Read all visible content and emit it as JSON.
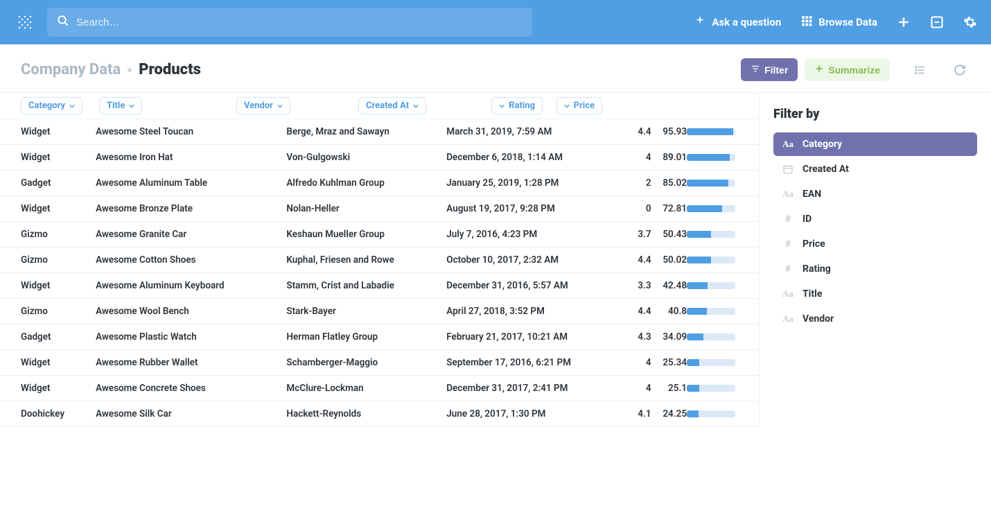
{
  "topbar": {
    "search_placeholder": "Search…",
    "ask_question": "Ask a question",
    "browse_data": "Browse Data"
  },
  "breadcrumb": {
    "root": "Company Data",
    "current": "Products"
  },
  "header_actions": {
    "filter": "Filter",
    "summarize": "Summarize"
  },
  "columns": {
    "category": "Category",
    "title": "Title",
    "vendor": "Vendor",
    "created_at": "Created At",
    "rating": "Rating",
    "price": "Price"
  },
  "max_price": 100,
  "rows": [
    {
      "category": "Widget",
      "title": "Awesome Steel Toucan",
      "vendor": "Berge, Mraz and Sawayn",
      "created_at": "March 31, 2019, 7:59 AM",
      "rating": "4.4",
      "price": "95.93"
    },
    {
      "category": "Widget",
      "title": "Awesome Iron Hat",
      "vendor": "Von-Gulgowski",
      "created_at": "December 6, 2018, 1:14 AM",
      "rating": "4",
      "price": "89.01"
    },
    {
      "category": "Gadget",
      "title": "Awesome Aluminum Table",
      "vendor": "Alfredo Kuhlman Group",
      "created_at": "January 25, 2019, 1:28 PM",
      "rating": "2",
      "price": "85.02"
    },
    {
      "category": "Widget",
      "title": "Awesome Bronze Plate",
      "vendor": "Nolan-Heller",
      "created_at": "August 19, 2017, 9:28 PM",
      "rating": "0",
      "price": "72.81"
    },
    {
      "category": "Gizmo",
      "title": "Awesome Granite Car",
      "vendor": "Keshaun Mueller Group",
      "created_at": "July 7, 2016, 4:23 PM",
      "rating": "3.7",
      "price": "50.43"
    },
    {
      "category": "Gizmo",
      "title": "Awesome Cotton Shoes",
      "vendor": "Kuphal, Friesen and Rowe",
      "created_at": "October 10, 2017, 2:32 AM",
      "rating": "4.4",
      "price": "50.02"
    },
    {
      "category": "Widget",
      "title": "Awesome Aluminum Keyboard",
      "vendor": "Stamm, Crist and Labadie",
      "created_at": "December 31, 2016, 5:57 AM",
      "rating": "3.3",
      "price": "42.48"
    },
    {
      "category": "Gizmo",
      "title": "Awesome Wool Bench",
      "vendor": "Stark-Bayer",
      "created_at": "April 27, 2018, 3:52 PM",
      "rating": "4.4",
      "price": "40.8"
    },
    {
      "category": "Gadget",
      "title": "Awesome Plastic Watch",
      "vendor": "Herman Flatley Group",
      "created_at": "February 21, 2017, 10:21 AM",
      "rating": "4.3",
      "price": "34.09"
    },
    {
      "category": "Widget",
      "title": "Awesome Rubber Wallet",
      "vendor": "Schamberger-Maggio",
      "created_at": "September 17, 2016, 6:21 PM",
      "rating": "4",
      "price": "25.34"
    },
    {
      "category": "Widget",
      "title": "Awesome Concrete Shoes",
      "vendor": "McClure-Lockman",
      "created_at": "December 31, 2017, 2:41 PM",
      "rating": "4",
      "price": "25.1"
    },
    {
      "category": "Doohickey",
      "title": "Awesome Silk Car",
      "vendor": "Hackett-Reynolds",
      "created_at": "June 28, 2017, 1:30 PM",
      "rating": "4.1",
      "price": "24.25"
    }
  ],
  "filter_panel": {
    "heading": "Filter by",
    "fields": [
      {
        "label": "Category",
        "icon": "aa",
        "selected": true
      },
      {
        "label": "Created At",
        "icon": "calendar",
        "selected": false
      },
      {
        "label": "EAN",
        "icon": "aa",
        "selected": false
      },
      {
        "label": "ID",
        "icon": "hash",
        "selected": false
      },
      {
        "label": "Price",
        "icon": "hash",
        "selected": false
      },
      {
        "label": "Rating",
        "icon": "hash",
        "selected": false
      },
      {
        "label": "Title",
        "icon": "aa",
        "selected": false
      },
      {
        "label": "Vendor",
        "icon": "aa",
        "selected": false
      }
    ]
  }
}
